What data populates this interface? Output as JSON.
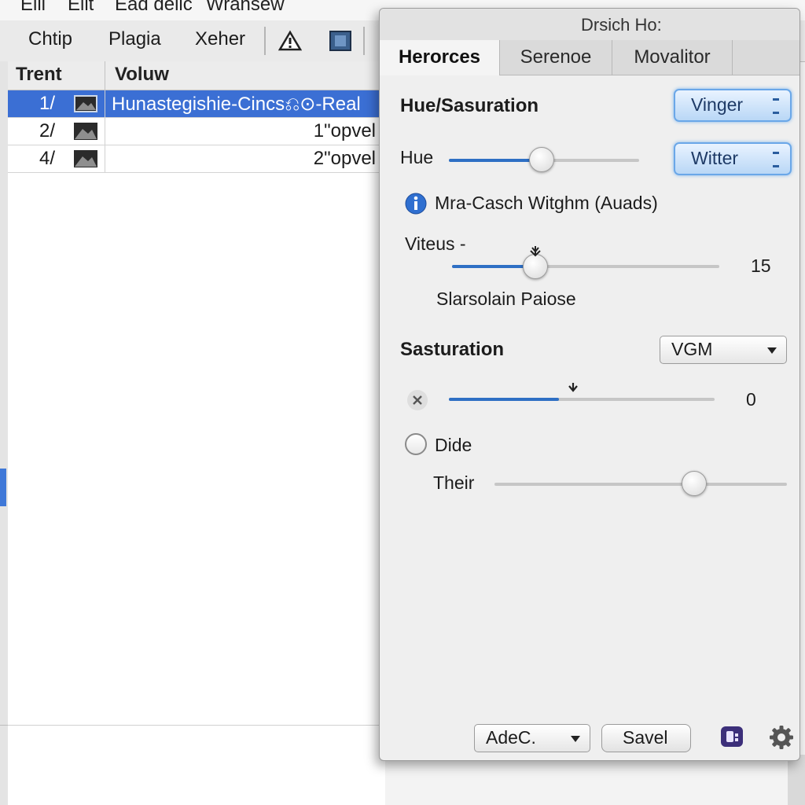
{
  "menubar": {
    "items": [
      "Elll",
      "Elit",
      "Ead delic",
      "Wransew"
    ]
  },
  "toolbar": {
    "items": [
      "Chtip",
      "Plagia",
      "Xeher"
    ]
  },
  "table": {
    "headers": [
      "Trent",
      "Voluw"
    ],
    "rows": [
      {
        "num": "1/",
        "name": "Hunastegishie-Cincs⎌⊙-Real",
        "value": "",
        "selected": true
      },
      {
        "num": "2/",
        "name": "",
        "value": "1\"opvel",
        "selected": false
      },
      {
        "num": "4/",
        "name": "",
        "value": "2\"opvel",
        "selected": false
      }
    ]
  },
  "panel": {
    "title": "Drsich Ho:",
    "tabs": [
      "Herorces",
      "Serenoe",
      "Movalitor"
    ],
    "active_tab": "Herorces",
    "section1": {
      "title": "Hue/Sasuration",
      "dropdown1": "Vinger",
      "dropdown2": "Witter"
    },
    "hue": {
      "label": "Hue",
      "value": 0.5
    },
    "info": {
      "text": "Mra-Casch Witghm (Auads)"
    },
    "vitreus": {
      "label": "Viteus -",
      "value": "15",
      "level": 0.33,
      "sublabel": "Slarsolain Paiose"
    },
    "saturation": {
      "title": "Sasturation",
      "select": "VGM",
      "value": "0",
      "level": 0.41
    },
    "option": {
      "label": "Dide",
      "checked": false
    },
    "their": {
      "label": "Their",
      "level": 0.7
    },
    "footer": {
      "add_select": "AdeC.",
      "save": "Savel"
    }
  },
  "colors": {
    "accent": "#3b6fd4",
    "slider_fill": "#2e6fc4",
    "pill_glow": "#7db5ee"
  },
  "icons": [
    "warning-icon",
    "image-icon",
    "info-icon",
    "close-icon",
    "cursor-icon",
    "app-icon",
    "gear-icon",
    "chevron-down-icon"
  ]
}
